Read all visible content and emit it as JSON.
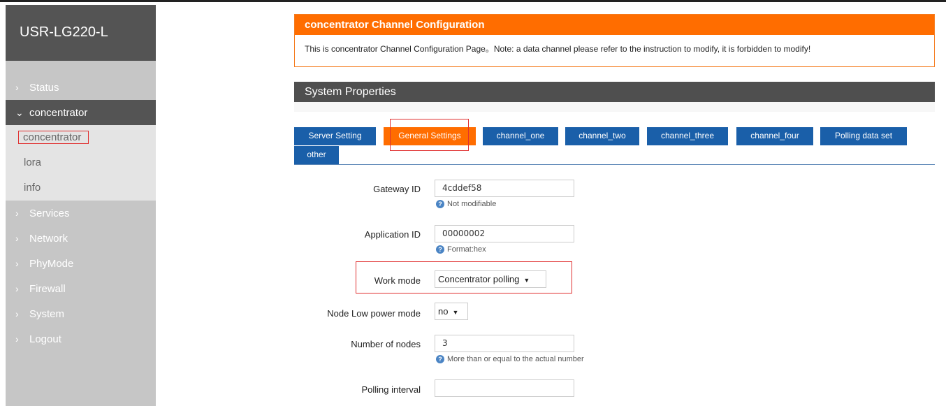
{
  "app": {
    "title": "USR-LG220-L"
  },
  "sidebar": {
    "items": [
      {
        "label": "Status",
        "chevron": "›"
      },
      {
        "label": "concentrator",
        "chevron": "⌄"
      },
      {
        "label": "concentrator"
      },
      {
        "label": "lora"
      },
      {
        "label": "info"
      },
      {
        "label": "Services",
        "chevron": "›"
      },
      {
        "label": "Network",
        "chevron": "›"
      },
      {
        "label": "PhyMode",
        "chevron": "›"
      },
      {
        "label": "Firewall",
        "chevron": "›"
      },
      {
        "label": "System",
        "chevron": "›"
      },
      {
        "label": "Logout",
        "chevron": "›"
      }
    ]
  },
  "alert": {
    "title": "concentrator Channel Configuration",
    "body": "This is concentrator Channel Configuration Page。Note: a data channel please refer to the instruction to modify, it is forbidden to modify!"
  },
  "section": {
    "title": "System Properties"
  },
  "tabs": [
    {
      "label": "Server Setting"
    },
    {
      "label": "General Settings"
    },
    {
      "label": "channel_one"
    },
    {
      "label": "channel_two"
    },
    {
      "label": "channel_three"
    },
    {
      "label": "channel_four"
    },
    {
      "label": "Polling data set"
    },
    {
      "label": "other"
    }
  ],
  "form": {
    "gateway_id": {
      "label": "Gateway ID",
      "value": "4cddef58",
      "hint": "Not modifiable"
    },
    "application_id": {
      "label": "Application ID",
      "value": "00000002",
      "hint": "Format:hex"
    },
    "work_mode": {
      "label": "Work mode",
      "value": "Concentrator polling"
    },
    "node_low_power": {
      "label": "Node Low power mode",
      "value": "no"
    },
    "number_of_nodes": {
      "label": "Number of nodes",
      "value": "3",
      "hint": "More than or equal to the actual number"
    },
    "polling_interval": {
      "label": "Polling interval",
      "value": ""
    }
  },
  "icons": {
    "help": "question-circle-icon",
    "dropdown": "caret-down-icon"
  },
  "colors": {
    "accent_orange": "#ff6d00",
    "tab_blue": "#1a5fa9",
    "sidebar_dark": "#545454",
    "sidebar_bg": "#c6c6c6",
    "highlight_red": "#e03030"
  }
}
